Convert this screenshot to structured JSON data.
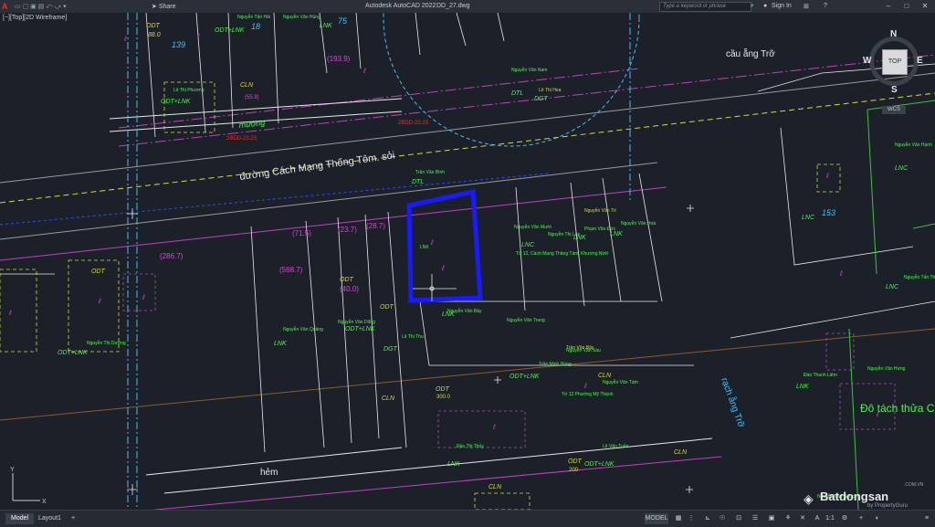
{
  "titlebar": {
    "app_icon": "A",
    "share_label": "Share",
    "app_title": "Autodesk AutoCAD 2022",
    "file_name": "DD_27.dwg",
    "search_placeholder": "Type a keyword or phrase",
    "sign_in": "Sign In"
  },
  "view_label": "[−][Top][2D Wireframe]",
  "viewcube": {
    "n": "N",
    "s": "S",
    "e": "E",
    "w": "W",
    "top": "TOP",
    "wcs": "WCS"
  },
  "drawing_text": {
    "road_main": "đường Cách Mạng Thống Tôm. sỏi",
    "bridge": "cầu ẵng Trỡ",
    "canal": "mương",
    "alley": "hẻm",
    "stream": "rạch ẵng Trỡ",
    "split_note": "Đô tách thửa C",
    "odt_880": "88.0",
    "area_1939": "(193.9)",
    "area_559": "(55.9)",
    "area_2867": "(286.7)",
    "area_715": "(71.5)",
    "area_237": "(23.7)",
    "area_287": "(28.7)",
    "area_5687": "(568.7)",
    "area_400": "(40.0)",
    "area_3000": "300.0",
    "area_200": "200",
    "odt": "ODT",
    "cln": "CLN",
    "lnk": "LNK",
    "lnc": "LNC",
    "odt_lnk": "ODT+LNK",
    "dtl": "DTL",
    "dgt": "DGT",
    "num_18": "18",
    "num_75": "75",
    "num_139": "139",
    "num_153": "153",
    "bddd": "2BDD-23.23"
  },
  "statusbar": {
    "tab_model": "Model",
    "tab_layout1": "Layout1",
    "tab_add": "+",
    "model_btn": "MODEL",
    "scale": "1:1"
  },
  "watermark": {
    "brand": "Batdongsan",
    "sub": "by PropertyGuru",
    "domain": ".COM.VN"
  },
  "colors": {
    "background": "#1c2129",
    "selection": "#1a1aff",
    "parcel": "#e8e8e8",
    "label_magenta": "#e040e0",
    "label_green": "#40ff40",
    "cyan": "#40c0ff",
    "yellow": "#d8d840"
  }
}
